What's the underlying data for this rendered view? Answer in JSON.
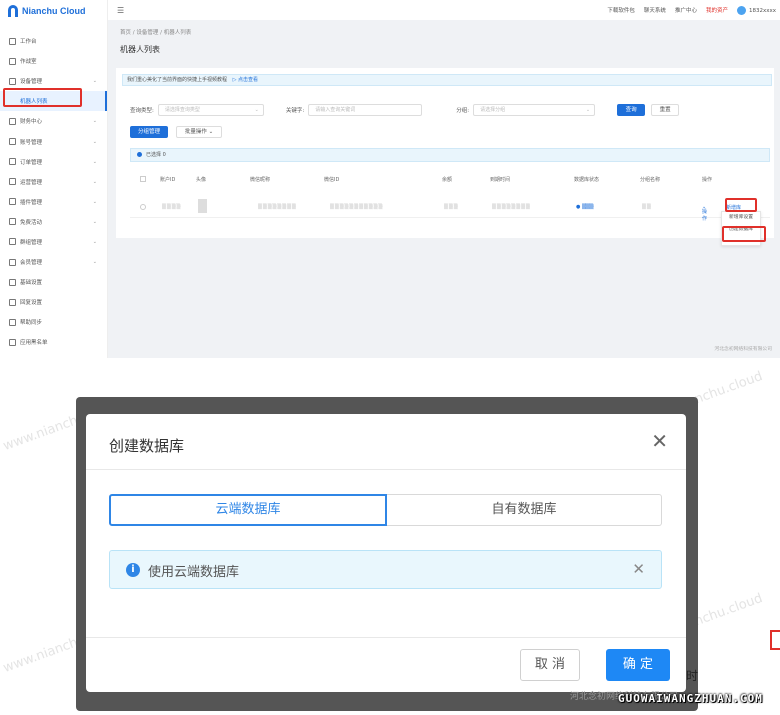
{
  "brand": {
    "name": "Nianchu Cloud"
  },
  "sidebar": {
    "items": [
      {
        "label": "工作台",
        "icon": "monitor-icon",
        "chev": false
      },
      {
        "label": "作战室",
        "icon": "gear-icon",
        "chev": false
      },
      {
        "label": "设备管理",
        "icon": "device-icon",
        "chev": true
      },
      {
        "label": "机器人列表",
        "icon": "",
        "chev": false,
        "active": true
      },
      {
        "label": "财务中心",
        "icon": "wallet-icon",
        "chev": true
      },
      {
        "label": "账号管理",
        "icon": "user-icon",
        "chev": true
      },
      {
        "label": "订单管理",
        "icon": "order-icon",
        "chev": true
      },
      {
        "label": "运营管理",
        "icon": "chart-icon",
        "chev": true
      },
      {
        "label": "插件管理",
        "icon": "plugin-icon",
        "chev": true
      },
      {
        "label": "免费活动",
        "icon": "gift-icon",
        "chev": true
      },
      {
        "label": "群组管理",
        "icon": "group-icon",
        "chev": true
      },
      {
        "label": "会员管理",
        "icon": "member-icon",
        "chev": true
      },
      {
        "label": "基础设置",
        "icon": "settings-icon",
        "chev": false
      },
      {
        "label": "回复设置",
        "icon": "reply-icon",
        "chev": false
      },
      {
        "label": "帮助同步",
        "icon": "help-icon",
        "chev": false
      },
      {
        "label": "应用黑名单",
        "icon": "block-icon",
        "chev": false
      }
    ]
  },
  "topbar": {
    "nav": [
      "下载软件包",
      "聊天系统",
      "推广中心"
    ],
    "assets": "我的资产",
    "phone": "1832xxxx"
  },
  "main": {
    "breadcrumb": "首页 / 设备管理 / 机器人列表",
    "title": "机器人列表",
    "info": "我们重心美化了当前界面的快捷上手视频教程",
    "info_link": "点击查看",
    "filters": {
      "type_label": "查询类型:",
      "type_placeholder": "请选择查询类型",
      "keyword_label": "关键字:",
      "keyword_placeholder": "请输入查询关键词",
      "group_label": "分组:",
      "group_placeholder": "请选择分组",
      "search": "查询",
      "reset": "重置"
    },
    "group_btn": "分组管理",
    "batch_btn": "批量操作",
    "selected": "已选择 0",
    "columns": [
      "账户ID",
      "头像",
      "微信昵称",
      "微信ID",
      "余额",
      "到期时间",
      "数据库状态",
      "分组名称",
      "操作"
    ],
    "row": {
      "ops": "操作",
      "more": "新增库"
    },
    "menu": [
      "新增库设置",
      "创建数据库"
    ],
    "copyright": "河北念初网络科技有限公司"
  },
  "modal": {
    "title": "创建数据库",
    "tab_cloud": "云端数据库",
    "tab_own": "自有数据库",
    "alert": "使用云端数据库",
    "cancel": "取 消",
    "ok": "确 定"
  },
  "overlay": {
    "site": "GUOWAIWANGZHUAN.COM",
    "footer": "河北念初网络科技有限公司",
    "side_char": "时",
    "watermark": "www.nianchu.cloud"
  }
}
